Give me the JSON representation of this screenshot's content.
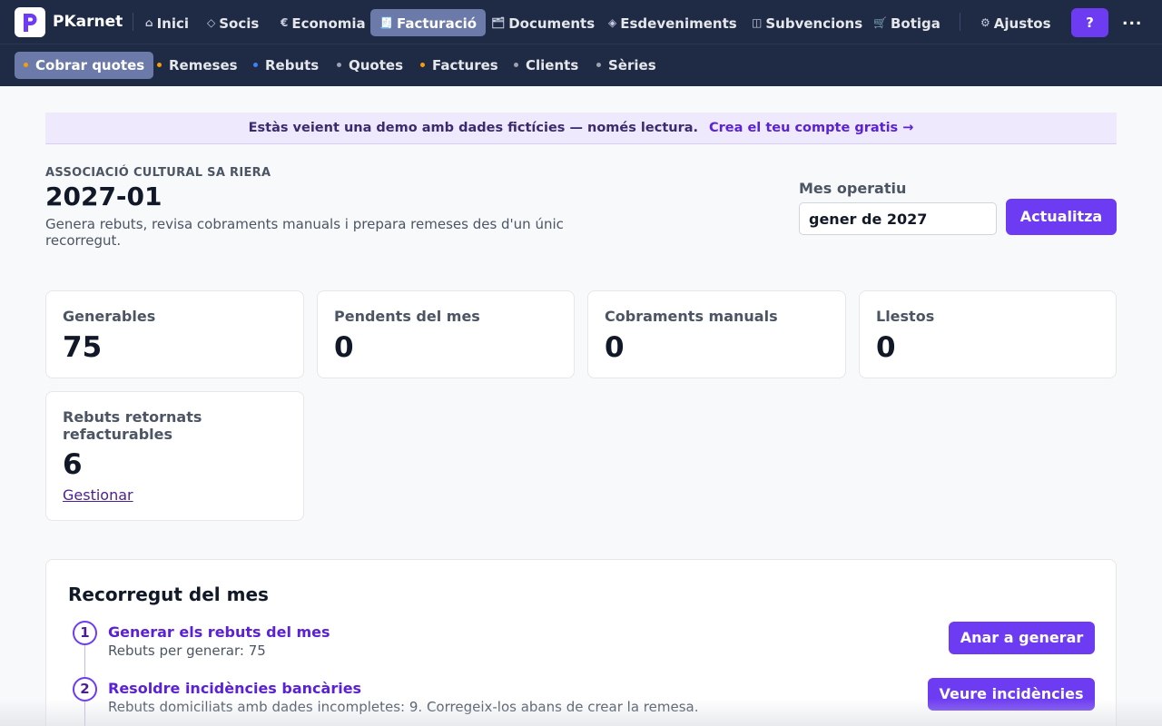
{
  "app": {
    "brand": "PKarnet",
    "logo_letter": "P"
  },
  "nav": {
    "items": [
      {
        "icon": "home-icon",
        "glyph": "⌂",
        "label": "Inici"
      },
      {
        "icon": "diamond-icon",
        "glyph": "◇",
        "label": "Socis"
      },
      {
        "icon": "euro-icon",
        "glyph": "€",
        "label": "Economia"
      },
      {
        "icon": "receipt-icon",
        "glyph": "🧾",
        "label": "Facturació",
        "active": true
      },
      {
        "icon": "folder-icon",
        "glyph": "🗂",
        "label": "Documents"
      },
      {
        "icon": "event-diamond-icon",
        "glyph": "◈",
        "label": "Esdeveniments"
      },
      {
        "icon": "columns-icon",
        "glyph": "◫",
        "label": "Subvencions"
      },
      {
        "icon": "cart-icon",
        "glyph": "🛒",
        "label": "Botiga"
      }
    ],
    "settings": {
      "glyph": "⚙",
      "label": "Ajustos"
    },
    "help_label": "?",
    "more_label": "..."
  },
  "subnav": {
    "items": [
      {
        "label": "Cobrar quotes",
        "dot_color": "#f59e0b",
        "active": true
      },
      {
        "label": "Remeses",
        "dot_color": "#f59e0b"
      },
      {
        "label": "Rebuts",
        "dot_color": "#3b82f6"
      },
      {
        "label": "Quotes",
        "dot_color": "#9ca3af"
      },
      {
        "label": "Factures",
        "dot_color": "#f59e0b"
      },
      {
        "label": "Clients",
        "dot_color": "#9ca3af"
      },
      {
        "label": "Sèries",
        "dot_color": "#9ca3af"
      }
    ]
  },
  "banner": {
    "text": "Estàs veient una demo amb dades fictícies — només lectura.",
    "link": "Crea el teu compte gratis →"
  },
  "header": {
    "org": "ASSOCIACIÓ CULTURAL SA RIERA",
    "period": "2027-01",
    "description": "Genera rebuts, revisa cobraments manuals i prepara remeses des d'un únic recorregut."
  },
  "month": {
    "label": "Mes operatiu",
    "value": "gener de 2027",
    "button": "Actualitza"
  },
  "cards": [
    {
      "label": "Generables",
      "value": "75"
    },
    {
      "label": "Pendents del mes",
      "value": "0"
    },
    {
      "label": "Cobraments manuals",
      "value": "0"
    },
    {
      "label": "Llestos",
      "value": "0"
    },
    {
      "label": "Rebuts retornats refacturables",
      "value": "6",
      "link": "Gestionar"
    }
  ],
  "journey": {
    "title": "Recorregut del mes",
    "steps": [
      {
        "num": "1",
        "title": "Generar els rebuts del mes",
        "subtitle": "Rebuts per generar: 75",
        "button": "Anar a generar"
      },
      {
        "num": "2",
        "title": "Resoldre incidències bancàries",
        "subtitle": "Rebuts domiciliats amb dades incompletes: 9. Corregeix-los abans de crear la remesa.",
        "button": "Veure incidències"
      }
    ]
  },
  "colors": {
    "nav_bg": "#1f2a44",
    "accent": "#6d3cf2",
    "active_tab": "#6b7aa8",
    "banner_bg": "#efe9fd"
  }
}
